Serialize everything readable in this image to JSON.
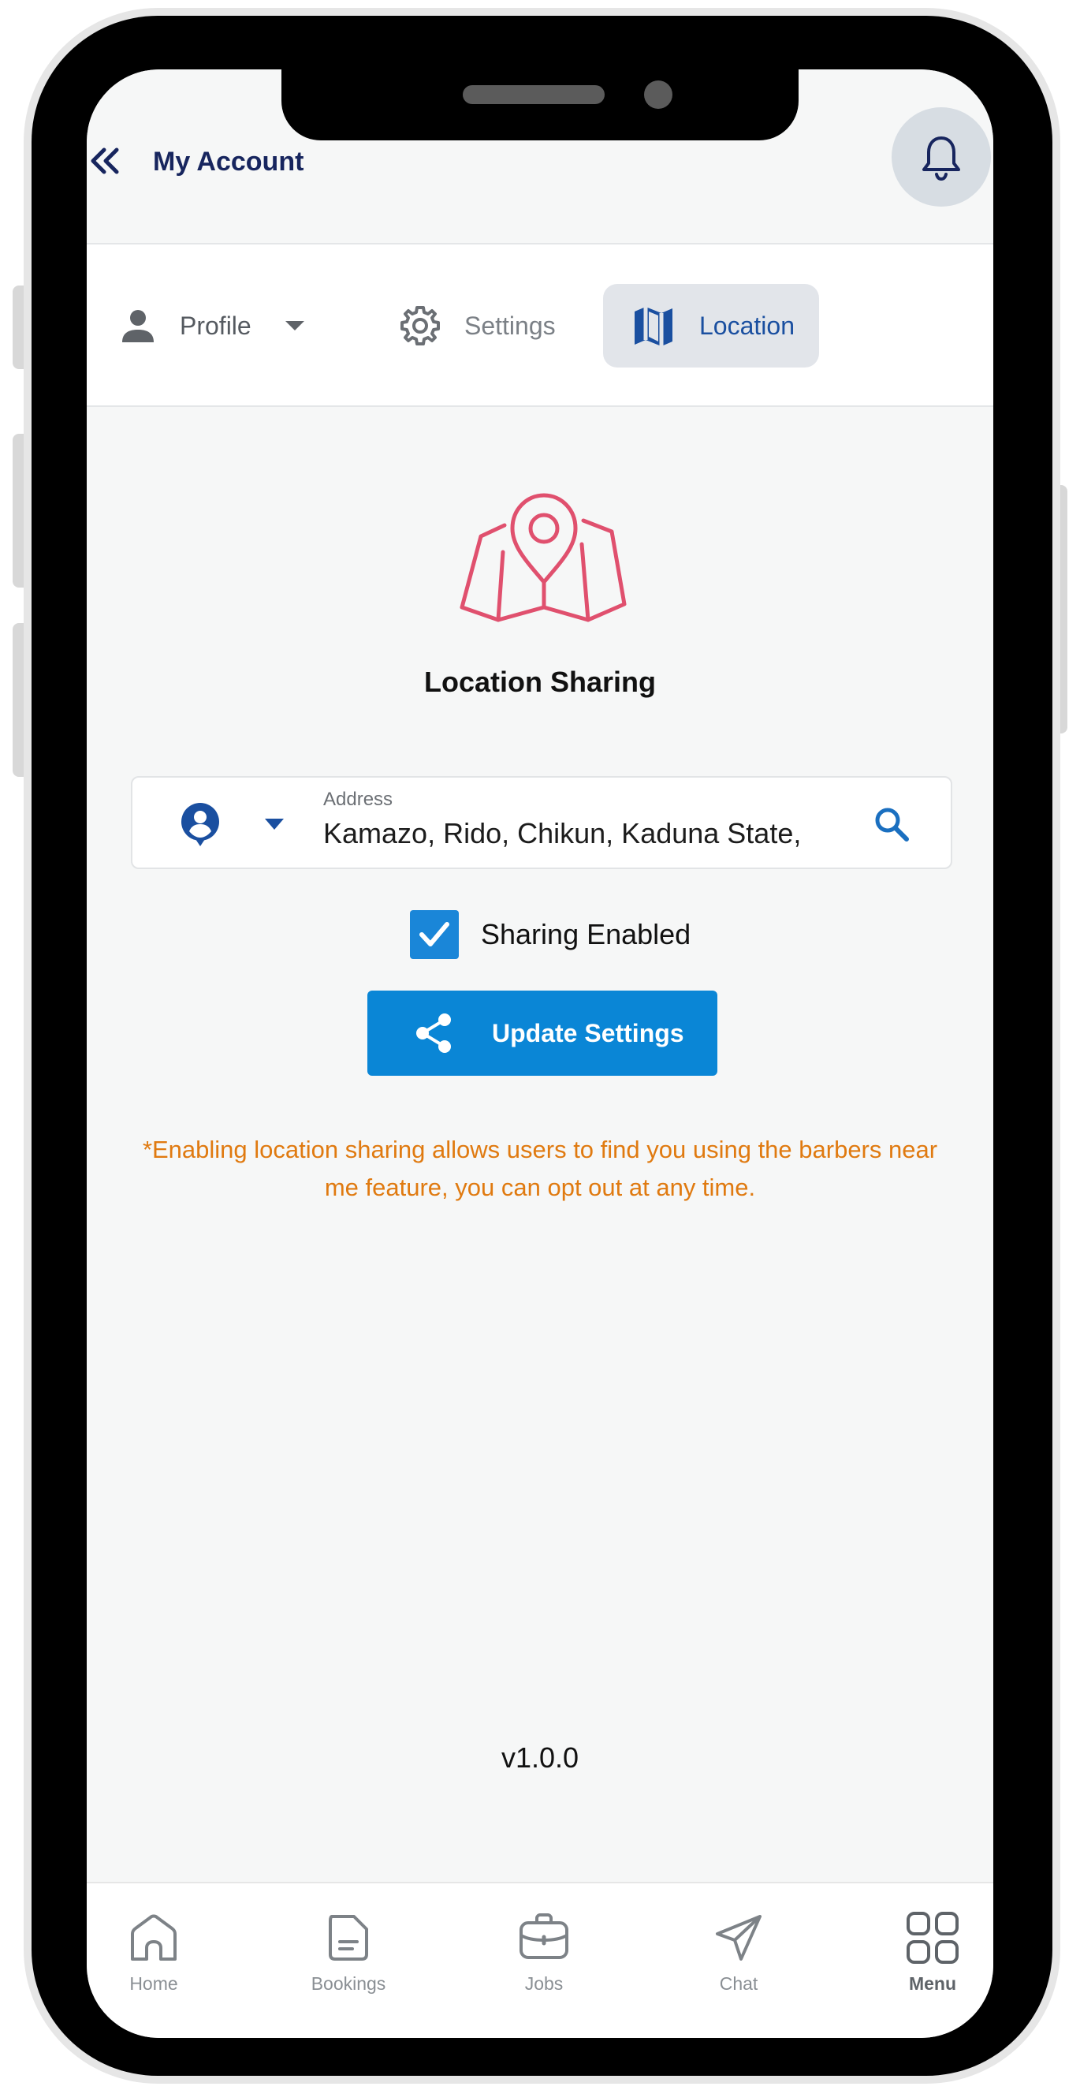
{
  "header": {
    "title": "My Account",
    "back_icon": "double-chevron-left-icon",
    "notification_icon": "bell-icon"
  },
  "tabs": [
    {
      "label": "Profile",
      "icon": "person-icon",
      "has_dropdown": true
    },
    {
      "label": "Settings",
      "icon": "gear-icon"
    },
    {
      "label": "Location",
      "icon": "map-icon",
      "active": true
    }
  ],
  "location": {
    "title": "Location Sharing",
    "address_label": "Address",
    "address_value": "Kamazo, Rido, Chikun, Kaduna State,",
    "sharing_label": "Sharing Enabled",
    "sharing_enabled": true,
    "update_button": "Update Settings",
    "note": "*Enabling location sharing allows users to find you using the barbers near me feature, you can opt out at any time."
  },
  "version": "v1.0.0",
  "bottom_nav": [
    {
      "label": "Home",
      "icon": "home-icon"
    },
    {
      "label": "Bookings",
      "icon": "document-icon"
    },
    {
      "label": "Jobs",
      "icon": "briefcase-icon"
    },
    {
      "label": "Chat",
      "icon": "send-icon"
    },
    {
      "label": "Menu",
      "icon": "grid-icon",
      "active": true
    }
  ],
  "colors": {
    "primary": "#0A86D6",
    "title_navy": "#17255E",
    "active_tab_text": "#1A4FA0",
    "map_icon": "#E0506E",
    "note": "#E07A10"
  }
}
